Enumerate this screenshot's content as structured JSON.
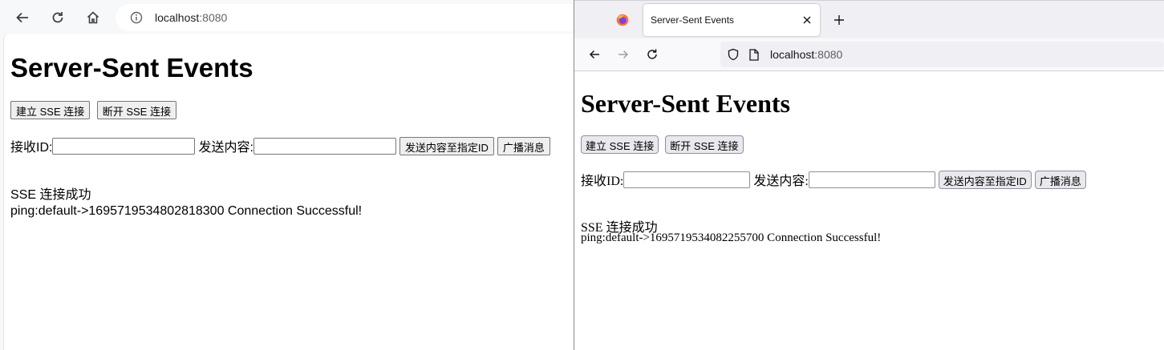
{
  "left_window": {
    "address": {
      "host": "localhost",
      "port": ":8080"
    },
    "icons": {
      "back": "back-arrow-icon",
      "reload": "reload-icon",
      "home": "home-icon",
      "info": "info-icon"
    },
    "page": {
      "title": "Server-Sent Events",
      "connect_button": "建立 SSE 连接",
      "disconnect_button": "断开 SSE 连接",
      "receiver_id_label": "接收ID:",
      "receiver_id_value": "",
      "content_label": "发送内容:",
      "content_value": "",
      "send_to_id_button": "发送内容至指定ID",
      "broadcast_button": "广播消息",
      "status_text": "SSE 连接成功",
      "message_text": "ping:default->1695719534802818300 Connection Successful!"
    }
  },
  "right_window": {
    "tab": {
      "title": "Server-Sent Events"
    },
    "address": {
      "host": "localhost",
      "port": ":8080"
    },
    "icons": {
      "logo": "firefox-logo-icon",
      "close": "close-icon",
      "new_tab": "plus-icon",
      "back": "back-arrow-icon",
      "forward": "forward-arrow-icon",
      "reload": "reload-icon",
      "shield": "shield-icon",
      "page": "page-icon"
    },
    "page": {
      "title": "Server-Sent Events",
      "connect_button": "建立 SSE 连接",
      "disconnect_button": "断开 SSE 连接",
      "receiver_id_label": "接收ID:",
      "receiver_id_value": "",
      "content_label": "发送内容:",
      "content_value": "",
      "send_to_id_button": "发送内容至指定ID",
      "broadcast_button": "广播消息",
      "status_text": "SSE 连接成功",
      "message_text": "ping:default->1695719534082255700 Connection Successful!"
    }
  },
  "colors": {
    "firefox_orange": "#ff7139",
    "firefox_purple": "#7542e5"
  }
}
